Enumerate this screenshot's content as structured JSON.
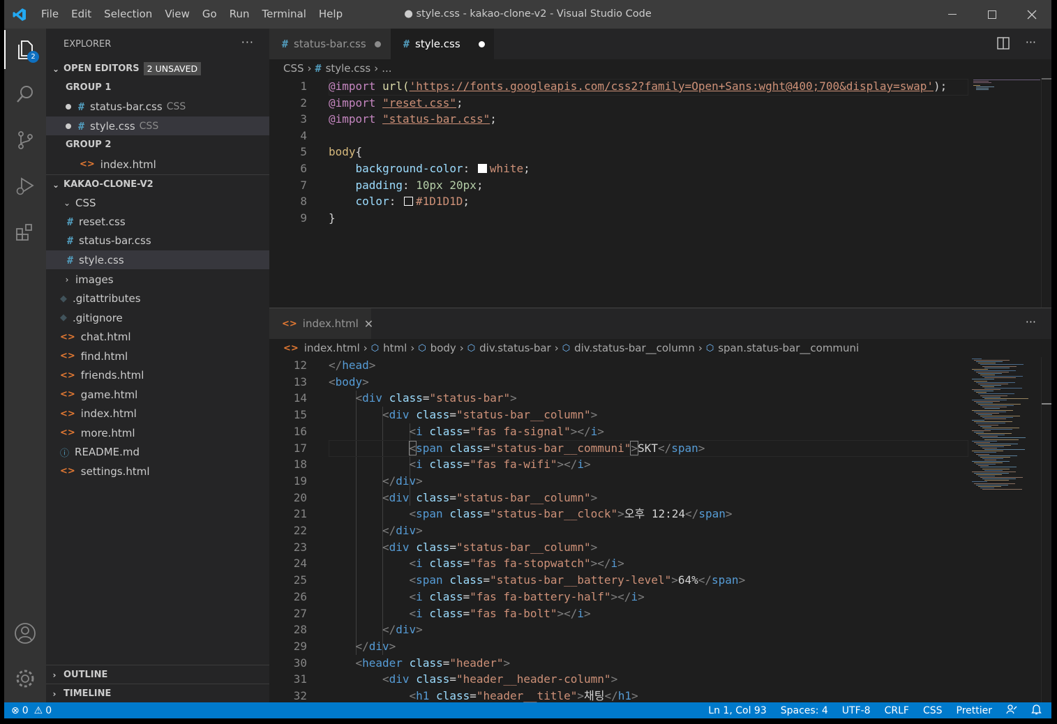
{
  "window": {
    "title": "● style.css - kakao-clone-v2 - Visual Studio Code",
    "menu": [
      "File",
      "Edit",
      "Selection",
      "View",
      "Go",
      "Run",
      "Terminal",
      "Help"
    ]
  },
  "activity": {
    "explorer_badge": "2"
  },
  "sidebar": {
    "header": "EXPLORER",
    "more": "···",
    "open_editors": {
      "label": "OPEN EDITORS",
      "unsaved": "2 UNSAVED"
    },
    "group1": "GROUP 1",
    "group1_files": [
      {
        "name": "status-bar.css",
        "lang": "CSS"
      },
      {
        "name": "style.css",
        "lang": "CSS"
      }
    ],
    "group2": "GROUP 2",
    "group2_files": [
      {
        "name": "index.html"
      }
    ],
    "project": "KAKAO-CLONE-V2",
    "folder_css": "CSS",
    "css_files": [
      "reset.css",
      "status-bar.css",
      "style.css"
    ],
    "other": [
      "images",
      ".gitattributes",
      ".gitignore",
      "chat.html",
      "find.html",
      "friends.html",
      "game.html",
      "index.html",
      "more.html",
      "README.md",
      "settings.html"
    ],
    "outline": "OUTLINE",
    "timeline": "TIMELINE"
  },
  "editor1": {
    "tabs": [
      {
        "label": "status-bar.css"
      },
      {
        "label": "style.css"
      }
    ],
    "crumbs": [
      "CSS",
      "style.css",
      "..."
    ],
    "lines": [
      {
        "n": "1",
        "a": "@import",
        "b": "url(",
        "c": "'https://fonts.googleapis.com/css2?family=Open+Sans:wght@400;700&display=swap'",
        "d": ");"
      },
      {
        "n": "2",
        "a": "@import",
        "c": "\"reset.css\"",
        "d": ";"
      },
      {
        "n": "3",
        "a": "@import",
        "c": "\"status-bar.css\"",
        "d": ";"
      },
      {
        "n": "4"
      },
      {
        "n": "5",
        "sel": "body",
        "d": "{"
      },
      {
        "n": "6",
        "prop": "background-color",
        "val": "white",
        "swatch": "#ffffff"
      },
      {
        "n": "7",
        "prop": "padding",
        "val": "10px 20px"
      },
      {
        "n": "8",
        "prop": "color",
        "val": "#1D1D1D",
        "swatch": "#1d1d1d"
      },
      {
        "n": "9",
        "d": "}"
      }
    ]
  },
  "editor2": {
    "tab": "index.html",
    "crumbs": [
      "index.html",
      "html",
      "body",
      "div.status-bar",
      "div.status-bar__column",
      "span.status-bar__communi"
    ],
    "lines": [
      {
        "n": "12",
        "ind": 0,
        "close": "head"
      },
      {
        "n": "13",
        "ind": 0,
        "open": "body"
      },
      {
        "n": "14",
        "ind": 1,
        "open": "div",
        "attr": "class",
        "val": "\"status-bar\""
      },
      {
        "n": "15",
        "ind": 2,
        "open": "div",
        "attr": "class",
        "val": "\"status-bar__column\""
      },
      {
        "n": "16",
        "ind": 3,
        "open": "i",
        "attr": "class",
        "val": "\"fas fa-signal\"",
        "end": "i"
      },
      {
        "n": "17",
        "ind": 3,
        "open": "span",
        "attr": "class",
        "val": "\"status-bar__communi\"",
        "text": "SKT",
        "end": "span"
      },
      {
        "n": "18",
        "ind": 3,
        "open": "i",
        "attr": "class",
        "val": "\"fas fa-wifi\"",
        "end": "i"
      },
      {
        "n": "19",
        "ind": 2,
        "close": "div"
      },
      {
        "n": "20",
        "ind": 2,
        "open": "div",
        "attr": "class",
        "val": "\"status-bar__column\""
      },
      {
        "n": "21",
        "ind": 3,
        "open": "span",
        "attr": "class",
        "val": "\"status-bar__clock\"",
        "text": "오후 12:24",
        "end": "span"
      },
      {
        "n": "22",
        "ind": 2,
        "close": "div"
      },
      {
        "n": "23",
        "ind": 2,
        "open": "div",
        "attr": "class",
        "val": "\"status-bar__column\""
      },
      {
        "n": "24",
        "ind": 3,
        "open": "i",
        "attr": "class",
        "val": "\"fas fa-stopwatch\"",
        "end": "i"
      },
      {
        "n": "25",
        "ind": 3,
        "open": "span",
        "attr": "class",
        "val": "\"status-bar__battery-level\"",
        "text": "64%",
        "end": "span"
      },
      {
        "n": "26",
        "ind": 3,
        "open": "i",
        "attr": "class",
        "val": "\"fas fa-battery-half\"",
        "end": "i"
      },
      {
        "n": "27",
        "ind": 3,
        "open": "i",
        "attr": "class",
        "val": "\"fas fa-bolt\"",
        "end": "i"
      },
      {
        "n": "28",
        "ind": 2,
        "close": "div"
      },
      {
        "n": "29",
        "ind": 1,
        "close": "div"
      },
      {
        "n": "30",
        "ind": 1,
        "open": "header",
        "attr": "class",
        "val": "\"header\""
      },
      {
        "n": "31",
        "ind": 2,
        "open": "div",
        "attr": "class",
        "val": "\"header__header-column\""
      },
      {
        "n": "32",
        "ind": 3,
        "open": "h1",
        "attr": "class",
        "val": "\"header__title\"",
        "text": "채팅",
        "end": "h1"
      }
    ]
  },
  "statusbar": {
    "errors": "0",
    "warnings": "0",
    "items": [
      "Ln 1, Col 93",
      "Spaces: 4",
      "UTF-8",
      "CRLF",
      "CSS",
      "Prettier"
    ]
  },
  "colors": {
    "accent": "#007acc",
    "titlebar": "#3c3c3c",
    "sidebar": "#252526",
    "editor": "#1e1e1e"
  }
}
